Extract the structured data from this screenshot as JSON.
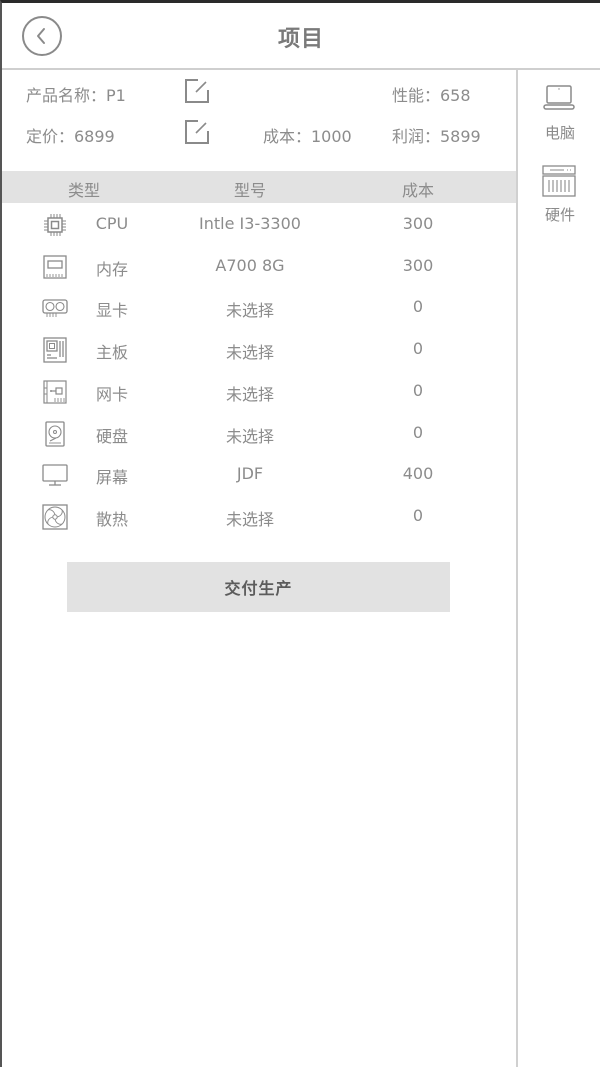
{
  "header": {
    "title": "项目",
    "back_icon": "chevron-left-circle-icon"
  },
  "info": {
    "product_name_label": "产品名称：P1",
    "performance_label": "性能：658",
    "price_label": "定价：6899",
    "cost_label": "成本：1000",
    "profit_label": "利润：5899",
    "edit_icon": "edit-square-icon"
  },
  "table": {
    "headers": [
      "类型",
      "型号",
      "成本"
    ],
    "rows": [
      {
        "icon": "cpu-chip-icon",
        "type": "CPU",
        "model": "Intle I3-3300",
        "cost": "300"
      },
      {
        "icon": "memory-stick-icon",
        "type": "内存",
        "model": "A700 8G",
        "cost": "300"
      },
      {
        "icon": "graphics-card-icon",
        "type": "显卡",
        "model": "未选择",
        "cost": "0"
      },
      {
        "icon": "motherboard-icon",
        "type": "主板",
        "model": "未选择",
        "cost": "0"
      },
      {
        "icon": "network-card-icon",
        "type": "网卡",
        "model": "未选择",
        "cost": "0"
      },
      {
        "icon": "hard-disk-icon",
        "type": "硬盘",
        "model": "未选择",
        "cost": "0"
      },
      {
        "icon": "monitor-icon",
        "type": "屏幕",
        "model": "JDF",
        "cost": "400"
      },
      {
        "icon": "cooling-fan-icon",
        "type": "散热",
        "model": "未选择",
        "cost": "0"
      }
    ]
  },
  "actions": {
    "deliver_label": "交付生产"
  },
  "sidebar": {
    "items": [
      {
        "icon": "laptop-icon",
        "label": "电脑"
      },
      {
        "icon": "hardware-rack-icon",
        "label": "硬件"
      }
    ]
  },
  "colors": {
    "text": "#8c8c8c",
    "header_bg": "#e2e2e2",
    "button_text": "#5c5c5c",
    "divider": "#d0d0d0"
  }
}
